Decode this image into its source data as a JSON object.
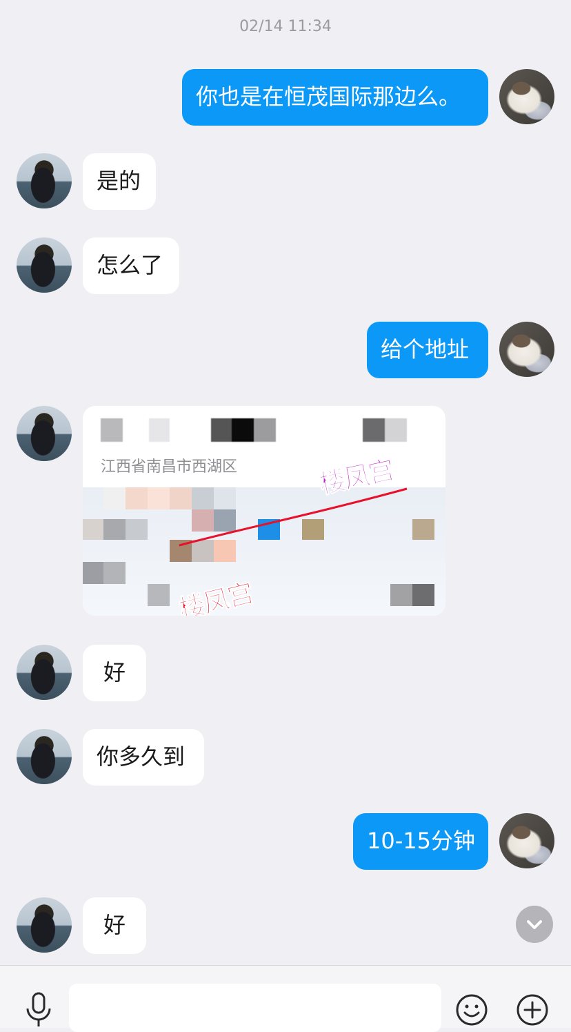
{
  "timestamp": "02/14 11:34",
  "messages": [
    {
      "side": "right",
      "text": "你也是在恒茂国际那边么。"
    },
    {
      "side": "left",
      "text": "是的"
    },
    {
      "side": "left",
      "text": "怎么了"
    },
    {
      "side": "right",
      "text": "给个地址"
    },
    {
      "side": "left",
      "type": "location",
      "address": "江西省南昌市西湖区"
    },
    {
      "side": "left",
      "text": "好"
    },
    {
      "side": "left",
      "text": "你多久到"
    },
    {
      "side": "right",
      "text": "10-15分钟"
    },
    {
      "side": "left",
      "text": "好"
    }
  ],
  "watermark": "楼凤宫",
  "colors": {
    "background": "#efeff4",
    "outgoing_bubble": "#0c98f6",
    "incoming_bubble": "#ffffff"
  },
  "icons": [
    "microphone-icon",
    "emoji-icon",
    "plus-icon",
    "chevron-down-icon"
  ]
}
